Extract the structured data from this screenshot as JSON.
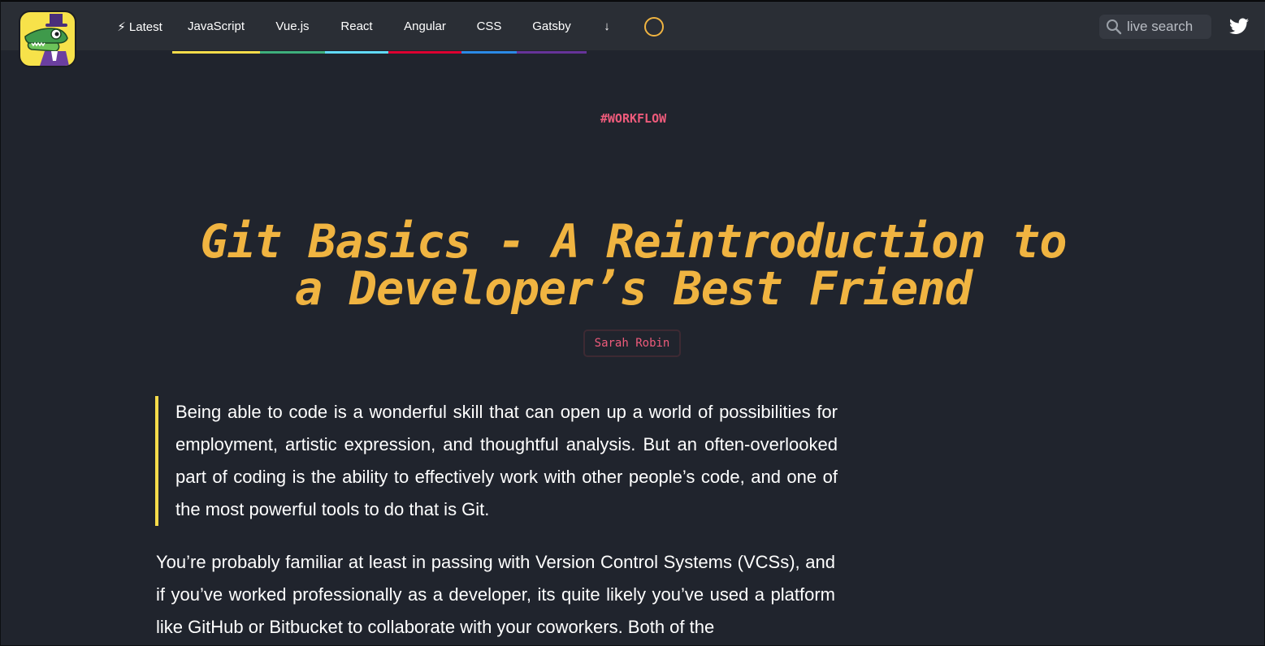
{
  "colors": {
    "background": "#20242d",
    "topbar": "#2a2e35",
    "accent": "#f0b441",
    "tag": "#ee5b7b",
    "logo_bg": "#f7e24a"
  },
  "nav": {
    "items": [
      {
        "label": "⚡ Latest",
        "underline": null
      },
      {
        "label": "JavaScript",
        "underline": "#f7dc4a"
      },
      {
        "label": "Vue.js",
        "underline": "#3eaf7c"
      },
      {
        "label": "React",
        "underline": "#61dafb"
      },
      {
        "label": "Angular",
        "underline": "#dd0031"
      },
      {
        "label": "CSS",
        "underline": "#2b8ae6"
      },
      {
        "label": "Gatsby",
        "underline": "#663399"
      },
      {
        "label": "↓",
        "underline": null
      }
    ]
  },
  "search": {
    "placeholder": "live search",
    "icon": "search-icon"
  },
  "social": {
    "icon": "twitter-icon"
  },
  "article": {
    "tag": "#WORKFLOW",
    "title": "Git Basics - A Reintroduction to a Developer’s Best Friend",
    "author": "Sarah Robin",
    "intro": "Being able to code is a wonderful skill that can open up a world of possibilities for employment, artistic expression, and thoughtful analysis. But an often-overlooked part of coding is the ability to effectively work with other people’s code, and one of the most powerful tools to do that is Git.",
    "paragraph": "You’re probably familiar at least in passing with Version Control Systems (VCSs), and if you’ve worked professionally as a developer, its quite likely you’ve used a platform like GitHub or Bitbucket to collaborate with your coworkers. Both of the"
  }
}
